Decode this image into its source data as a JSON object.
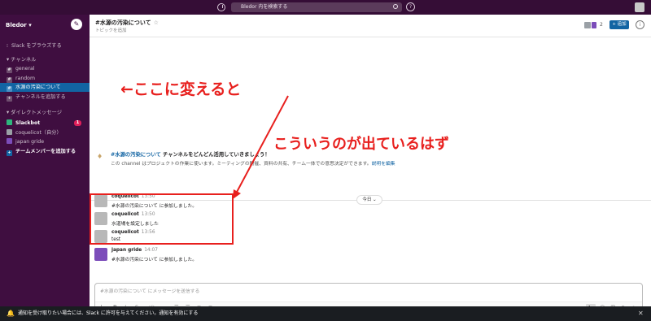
{
  "topbar": {
    "search_placeholder": "Bledor 内を検索する"
  },
  "sidebar": {
    "workspace": "Bledor",
    "browse": "Slack をブラウズする",
    "channels_header": "チャンネル",
    "channels": [
      {
        "label": "general",
        "active": false
      },
      {
        "label": "random",
        "active": false
      },
      {
        "label": "水源の汚染について",
        "active": true
      }
    ],
    "add_channel": "チャンネルを追加する",
    "dm_header": "ダイレクトメッセージ",
    "dms": [
      {
        "label": "Slackbot",
        "badge": "1",
        "color": "#2eb67d"
      },
      {
        "label": "coquelicot（自分）",
        "color": "#9aa0a6"
      },
      {
        "label": "japan gride",
        "color": "#7c4dba"
      }
    ],
    "add_member": "チームメンバーを追加する"
  },
  "header": {
    "title": "#水源の汚染について",
    "topic": "トピックを追加",
    "member_count": "2",
    "add_label": "+ 追加"
  },
  "intro": {
    "channel": "#水源の汚染について",
    "headline": " チャンネルをどんどん活用していきましょう！",
    "line_prefix": "この channel はプロジェクトの作業に使います。ミーティングの開催、資料の共有、チーム一体での意思決定ができます。",
    "line_link": "説明を編集"
  },
  "divider": {
    "label": "今日 ⌄"
  },
  "messages": [
    {
      "name": "coquelicot",
      "time": "13:50",
      "text": "#水源の汚染について に参加しました。",
      "avatar": "#b8b8b8"
    },
    {
      "name": "coquelicot",
      "time": "13:50",
      "text": "水道場を設定しました",
      "avatar": "#b8b8b8"
    },
    {
      "name": "coquelicot",
      "time": "13:56",
      "text": "test",
      "avatar": "#b8b8b8"
    },
    {
      "name": "japan gride",
      "time": "14:07",
      "text": "#水源の汚染について に参加しました。",
      "avatar": "#7c4dba"
    }
  ],
  "composer": {
    "placeholder": "#水源の汚染について にメッセージを送信する"
  },
  "banner": {
    "text": "通知を受け取りたい場合には、Slack に許可を与えてください。通知を有効にする"
  },
  "annotations": {
    "first": "←ここに変えると",
    "second": "こういうのが出ているはず"
  },
  "colors": {
    "annotation": "#e8201e",
    "sidebar": "#3f0e40",
    "active": "#1264a3"
  }
}
